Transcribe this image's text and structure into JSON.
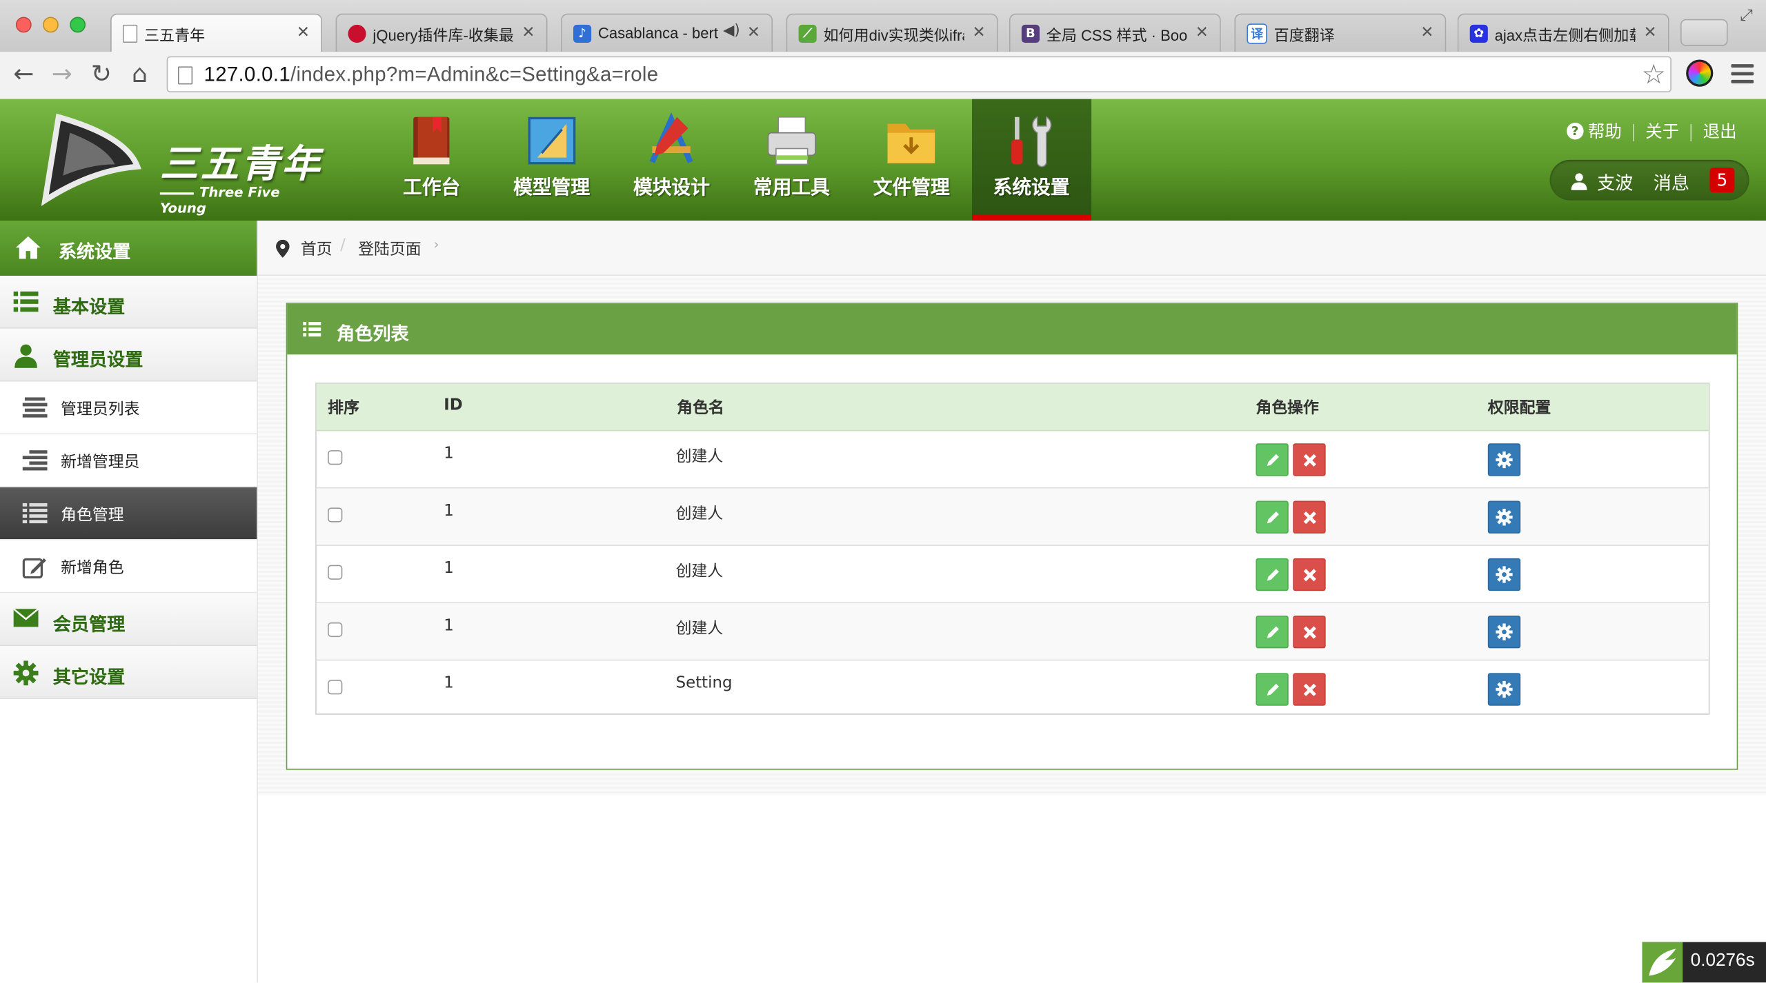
{
  "browser": {
    "tabs": [
      {
        "title": "三五青年",
        "active": true,
        "favicon": "page-icon"
      },
      {
        "title": "jQuery插件库-收集最",
        "active": false,
        "favicon": "jquery-icon"
      },
      {
        "title": "Casablanca - bert",
        "active": false,
        "favicon": "app-icon"
      },
      {
        "title": "如何用div实现类似ifra",
        "active": false,
        "favicon": "leaf-icon"
      },
      {
        "title": "全局 CSS 样式 · Boots",
        "active": false,
        "favicon": "bootstrap-icon"
      },
      {
        "title": "百度翻译",
        "active": false,
        "favicon": "translate-icon"
      },
      {
        "title": "ajax点击左侧右侧加载",
        "active": false,
        "favicon": "baidu-paw-icon"
      }
    ],
    "url_host": "127.0.0.1",
    "url_path": "/index.php?m=Admin&c=Setting&a=role"
  },
  "header": {
    "logo_text": "三五青年",
    "logo_sub": "Three Five Young",
    "nav": [
      {
        "label": "工作台",
        "icon": "book-icon"
      },
      {
        "label": "模型管理",
        "icon": "ruler-icon"
      },
      {
        "label": "模块设计",
        "icon": "design-tools-icon"
      },
      {
        "label": "常用工具",
        "icon": "printer-icon"
      },
      {
        "label": "文件管理",
        "icon": "folder-icon"
      },
      {
        "label": "系统设置",
        "icon": "wrench-screwdriver-icon",
        "active": true
      }
    ],
    "links": {
      "help": "帮助",
      "about": "关于",
      "logout": "退出"
    },
    "user": {
      "name": "支波",
      "messages_label": "消息",
      "messages_count": "5"
    }
  },
  "sidebar": {
    "title": "系统设置",
    "groups": [
      {
        "label": "基本设置",
        "icon": "list-icon"
      },
      {
        "label": "管理员设置",
        "icon": "user-icon"
      }
    ],
    "sub_items": [
      {
        "label": "管理员列表",
        "icon": "align-icon"
      },
      {
        "label": "新增管理员",
        "icon": "indent-icon"
      },
      {
        "label": "角色管理",
        "icon": "list-icon",
        "active": true
      },
      {
        "label": "新增角色",
        "icon": "edit-icon"
      }
    ],
    "groups_after": [
      {
        "label": "会员管理",
        "icon": "envelope-icon"
      },
      {
        "label": "其它设置",
        "icon": "gear-icon"
      }
    ]
  },
  "breadcrumb": {
    "home": "首页",
    "current": "登陆页面"
  },
  "panel": {
    "title": "角色列表"
  },
  "table": {
    "headers": {
      "sort": "排序",
      "id": "ID",
      "name": "角色名",
      "ops": "角色操作",
      "perm": "权限配置"
    },
    "rows": [
      {
        "id": "1",
        "name": "创建人"
      },
      {
        "id": "1",
        "name": "创建人"
      },
      {
        "id": "1",
        "name": "创建人"
      },
      {
        "id": "1",
        "name": "创建人"
      },
      {
        "id": "1",
        "name": "Setting"
      }
    ]
  },
  "footer": {
    "timer": "0.0276s"
  },
  "colors": {
    "brand_green": "#6aa145",
    "active_red": "#d90000",
    "table_header": "#dff0d8",
    "edit_green": "#62c462",
    "delete_red": "#da4f49",
    "config_blue": "#337ab7"
  }
}
